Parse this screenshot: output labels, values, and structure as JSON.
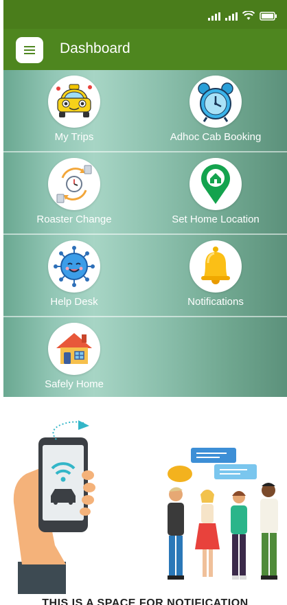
{
  "header": {
    "title": "Dashboard"
  },
  "tiles": [
    {
      "label": "My Trips",
      "icon": "taxi-icon"
    },
    {
      "label": "Adhoc Cab Booking",
      "icon": "alarm-clock-icon"
    },
    {
      "label": "Roaster Change",
      "icon": "schedule-change-icon"
    },
    {
      "label": "Set Home Location",
      "icon": "home-location-pin-icon"
    },
    {
      "label": "Help Desk",
      "icon": "help-desk-icon"
    },
    {
      "label": "Notifications",
      "icon": "bell-icon"
    },
    {
      "label": "Safely Home",
      "icon": "house-icon"
    }
  ],
  "banner": {
    "title": "THIS IS A SPACE FOR NOTIFICATION"
  },
  "colors": {
    "appbar": "#4e861f",
    "statusbar": "#4a7d1b",
    "panel": "#8cc0ad"
  }
}
